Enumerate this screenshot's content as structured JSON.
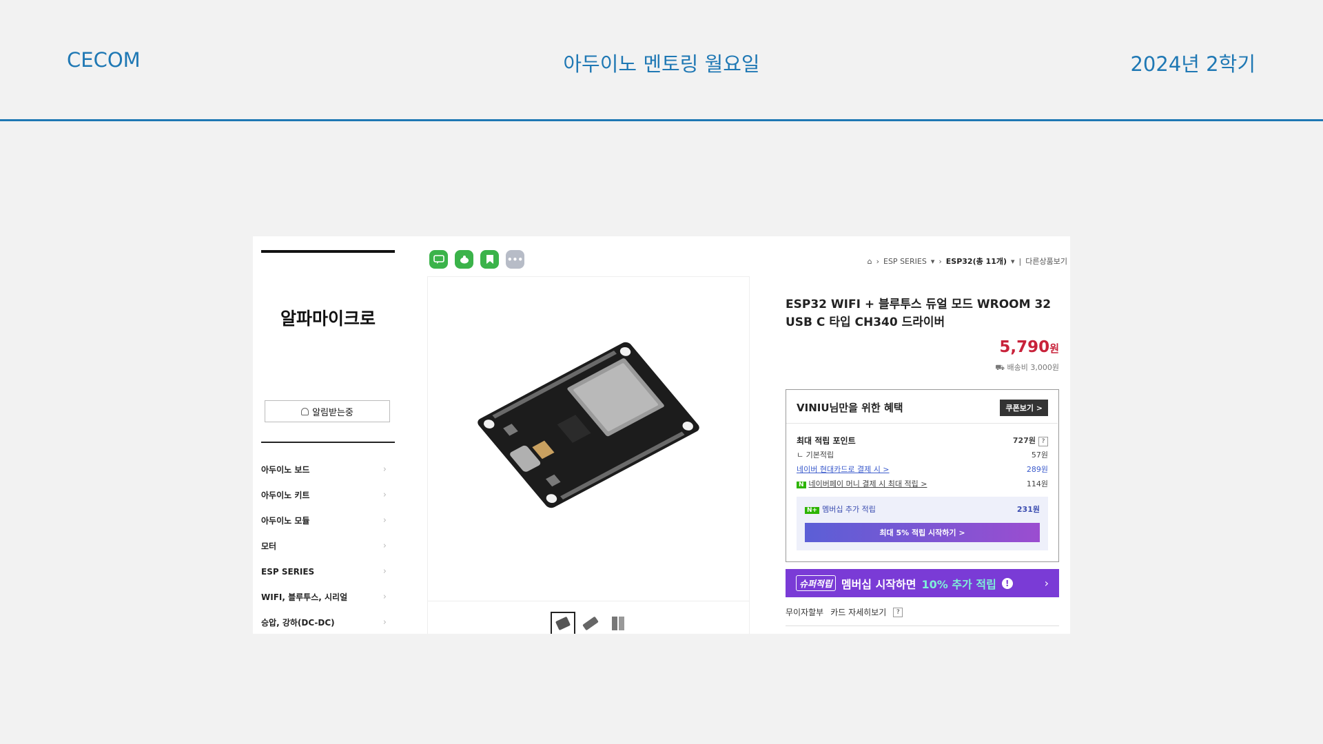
{
  "slide": {
    "left": "CECOM",
    "center": "아두이노 멘토링 월요일",
    "right": "2024년 2학기"
  },
  "store": {
    "name": "알파마이크로",
    "alarm_label": "알림받는중",
    "categories": [
      "아두이노 보드",
      "아두이노 키트",
      "아두이노 모듈",
      "모터",
      "ESP SERIES",
      "WIFI, 블루투스, 시리얼",
      "승압, 강하(DC-DC)"
    ]
  },
  "breadcrumb": {
    "level1": "ESP SERIES",
    "level2": "ESP32(총 11개)",
    "more": "다른상품보기"
  },
  "product": {
    "title": "ESP32 WIFI + 블루투스 듀얼 모드 WROOM 32 USB C 타입 CH340 드라이버",
    "price": "5,790",
    "price_unit": "원",
    "shipping": "배송비 3,000원"
  },
  "benefit": {
    "header": "VINIU님만을 위한 혜택",
    "coupon_button": "쿠폰보기 >",
    "max_points_label": "최대 적립 포인트",
    "max_points_value": "727원",
    "basic_label": "기본적립",
    "basic_value": "57원",
    "card_label": "네이버 현대카드로 결제 시 >",
    "card_value": "289원",
    "naverpay_label": "네이버페이 머니 결제 시 최대 적립 >",
    "naverpay_value": "114원",
    "membership_label": "멤버십 추가 적립",
    "membership_value": "231원",
    "start_button": "최대 5% 적립 시작하기 >"
  },
  "super": {
    "tag": "슈퍼적립",
    "text": "멤버십 시작하면",
    "highlight": "10% 추가 적립"
  },
  "installment": {
    "label": "무이자할부",
    "card_details": "카드 자세히보기"
  }
}
